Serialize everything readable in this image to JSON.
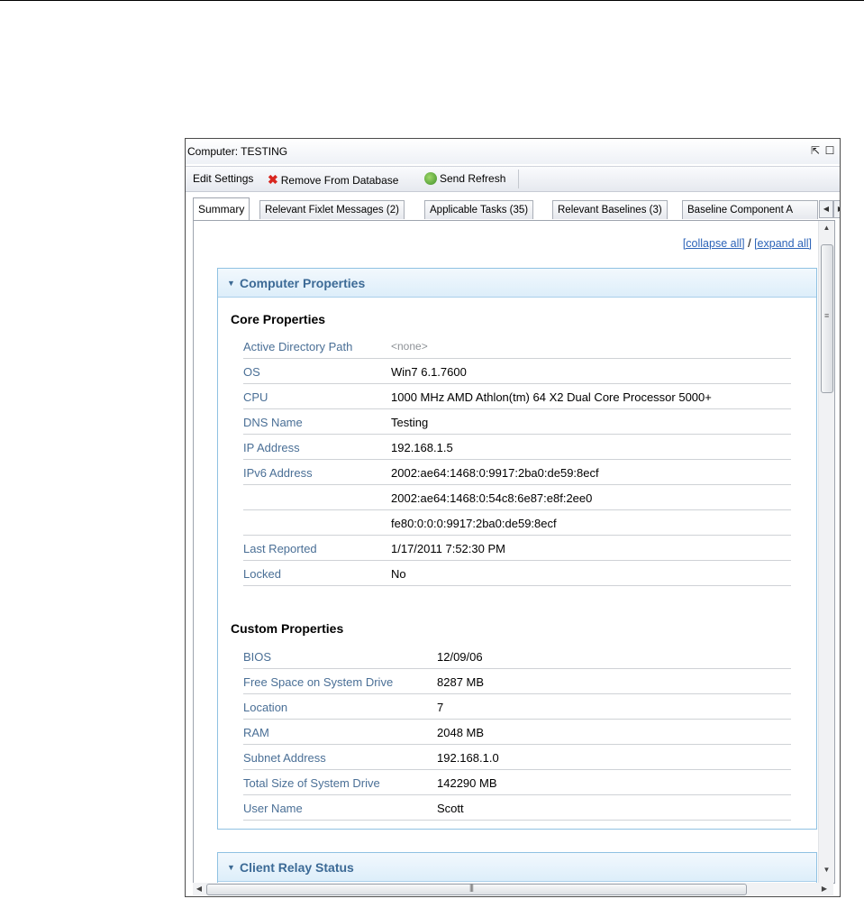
{
  "window": {
    "title": "Computer: TESTING"
  },
  "toolbar": {
    "edit_settings": "Edit Settings",
    "remove_from_database": "Remove From Database",
    "send_refresh": "Send Refresh"
  },
  "tabs": [
    {
      "label": "Summary"
    },
    {
      "label": "Relevant Fixlet Messages (2)"
    },
    {
      "label": "Applicable Tasks (35)"
    },
    {
      "label": "Relevant Baselines (3)"
    },
    {
      "label": "Baseline Component A"
    }
  ],
  "links": {
    "collapse_all": "[collapse all]",
    "separator": "/",
    "expand_all": "[expand all]"
  },
  "computer_properties": {
    "title": "Computer Properties",
    "core": {
      "title": "Core Properties",
      "rows": [
        {
          "name": "Active Directory Path",
          "value": "<none>"
        },
        {
          "name": "OS",
          "value": "Win7 6.1.7600"
        },
        {
          "name": "CPU",
          "value": "1000 MHz AMD Athlon(tm) 64 X2 Dual Core Processor 5000+"
        },
        {
          "name": "DNS Name",
          "value": "Testing"
        },
        {
          "name": "IP Address",
          "value": "192.168.1.5"
        },
        {
          "name": "IPv6 Address",
          "value": "2002:ae64:1468:0:9917:2ba0:de59:8ecf"
        },
        {
          "name": "",
          "value": "2002:ae64:1468:0:54c8:6e87:e8f:2ee0"
        },
        {
          "name": "",
          "value": "fe80:0:0:0:9917:2ba0:de59:8ecf"
        },
        {
          "name": "Last Reported",
          "value": "1/17/2011 7:52:30 PM"
        },
        {
          "name": "Locked",
          "value": "No"
        }
      ]
    },
    "custom": {
      "title": "Custom Properties",
      "rows": [
        {
          "name": "BIOS",
          "value": "12/09/06"
        },
        {
          "name": "Free Space on System Drive",
          "value": "8287 MB"
        },
        {
          "name": "Location",
          "value": "7"
        },
        {
          "name": "RAM",
          "value": "2048 MB"
        },
        {
          "name": "Subnet Address",
          "value": "192.168.1.0"
        },
        {
          "name": "Total Size of System Drive",
          "value": "142290 MB"
        },
        {
          "name": "User Name",
          "value": "Scott"
        }
      ]
    }
  },
  "client_relay_status": {
    "title": "Client Relay Status"
  },
  "colors": {
    "accent_link": "#2d64b8",
    "panel_title": "#3c6a96",
    "remove_icon": "#d8261f"
  }
}
